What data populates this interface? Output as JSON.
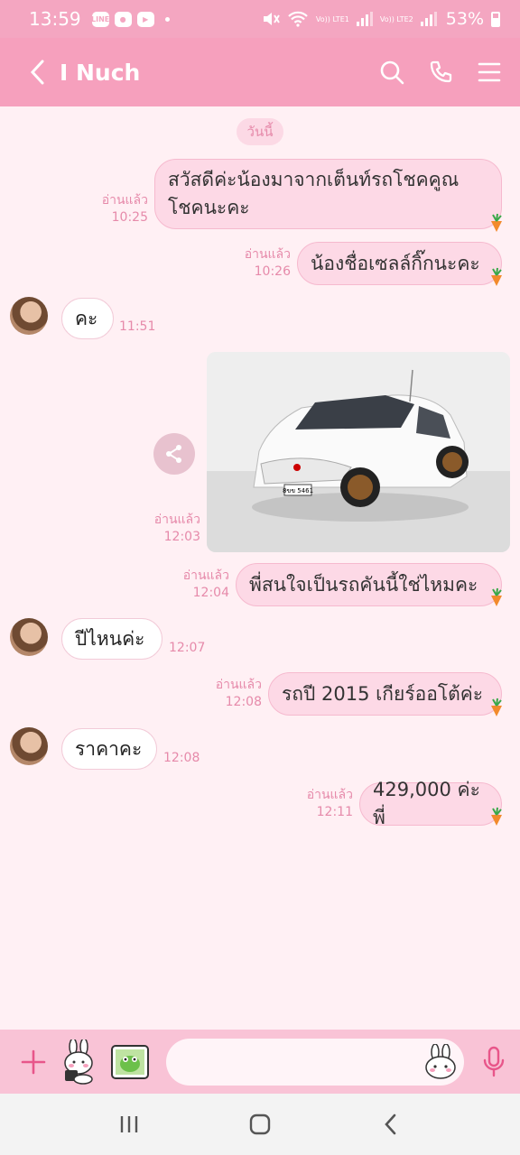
{
  "status_bar": {
    "time": "13:59",
    "app_icons": [
      "LINE",
      "●",
      "▶"
    ],
    "volte1": "Vo)) LTE1",
    "volte2": "Vo)) LTE2",
    "battery": "53%"
  },
  "header": {
    "title": "I Nuch",
    "icons": [
      "back-arrow-icon",
      "search-icon",
      "phone-icon",
      "menu-icon"
    ],
    "color": "#f6a0bd"
  },
  "chat": {
    "date_label": "วันนี้",
    "messages": [
      {
        "side": "out",
        "lines": [
          "สวัสดีค่ะน้องมาจากเต็นท์รถโชคคูณ",
          "โชคนะคะ"
        ],
        "read": "อ่านแล้ว",
        "time": "10:25"
      },
      {
        "side": "out",
        "text": "น้องชื่อเซลล์กิ๊กนะคะ",
        "read": "อ่านแล้ว",
        "time": "10:26"
      },
      {
        "side": "in",
        "text": "คะ",
        "time": "11:51"
      },
      {
        "side": "out",
        "type": "image",
        "image_text": "8ขข 5461",
        "read": "อ่านแล้ว",
        "time": "12:03"
      },
      {
        "side": "out",
        "text": "พี่สนใจเป็นรถคันนี้ใช่ไหมคะ",
        "read": "อ่านแล้ว",
        "time": "12:04"
      },
      {
        "side": "in",
        "text": "ปีไหนค่ะ",
        "time": "12:07"
      },
      {
        "side": "out",
        "text": "รถปี 2015 เกียร์ออโต้ค่ะ",
        "read": "อ่านแล้ว",
        "time": "12:08"
      },
      {
        "side": "in",
        "text": "ราคาคะ",
        "time": "12:08"
      },
      {
        "side": "out",
        "text": "429,000 ค่ะพี่",
        "read": "อ่านแล้ว",
        "time": "12:11"
      }
    ]
  },
  "input_bar": {
    "placeholder": "",
    "icons": [
      "plus-icon",
      "sticker-icon",
      "gallery-icon",
      "emoji-icon",
      "microphone-icon"
    ]
  },
  "nav_bar": {
    "icons": [
      "recent-apps-icon",
      "home-icon",
      "back-icon"
    ]
  },
  "colors": {
    "accent": "#f6a0bd",
    "bubble_out": "#fdd9e6",
    "bubble_in": "#ffffff",
    "meta_text": "#e68aaa",
    "background": "#fff0f4"
  }
}
